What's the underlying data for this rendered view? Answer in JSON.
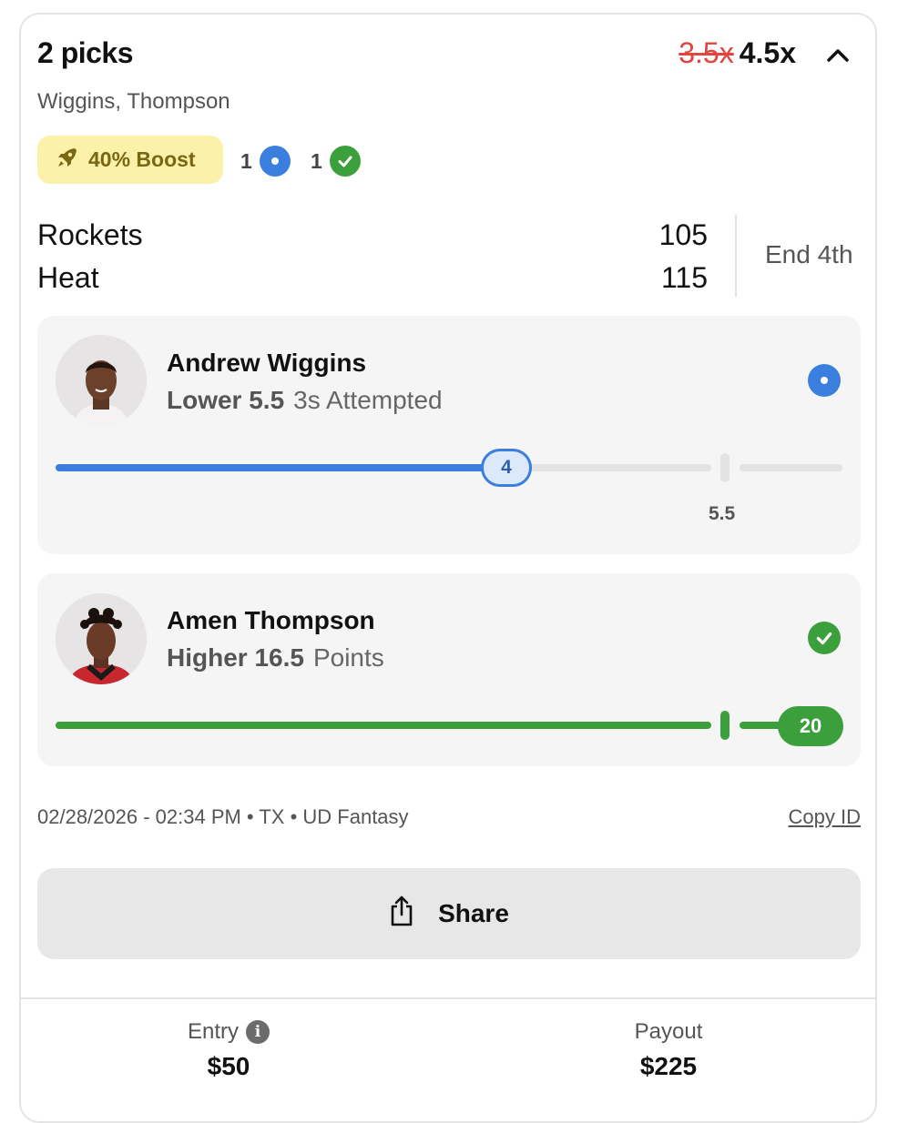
{
  "entry": {
    "title": "2 picks",
    "players_summary": "Wiggins, Thompson",
    "multiplier_old": "3.5x",
    "multiplier_new": "4.5x",
    "boost_label": "40% Boost",
    "live_count": "1",
    "won_count": "1"
  },
  "game": {
    "team1": "Rockets",
    "score1": "105",
    "team2": "Heat",
    "score2": "115",
    "status": "End 4th"
  },
  "picks": [
    {
      "player": "Andrew Wiggins",
      "direction": "Lower 5.5",
      "stat": "3s Attempted",
      "current": "4",
      "line_label": "5.5",
      "status": "live",
      "progress_fraction": 0.66
    },
    {
      "player": "Amen Thompson",
      "direction": "Higher 16.5",
      "stat": "Points",
      "current": "20",
      "status": "won",
      "progress_fraction": 1.0
    }
  ],
  "meta": {
    "timestamp_location": "02/28/2026 - 02:34 PM • TX • UD Fantasy",
    "copy_id_label": "Copy ID"
  },
  "share_label": "Share",
  "footer": {
    "entry_label": "Entry",
    "entry_value": "$50",
    "payout_label": "Payout",
    "payout_value": "$225"
  },
  "colors": {
    "live_blue": "#3a7fde",
    "won_green": "#3ba03c",
    "boost_bg": "#fbf1a9",
    "old_multiplier_red": "#e0463f"
  }
}
